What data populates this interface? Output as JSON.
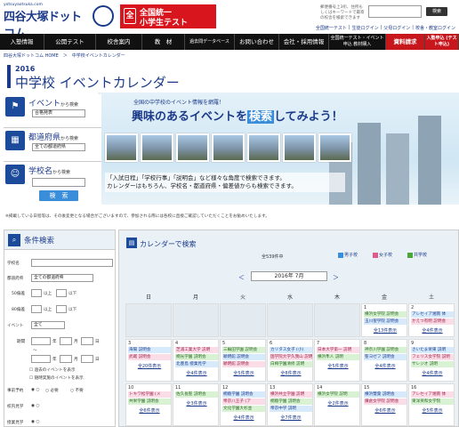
{
  "header": {
    "logo_top": "yotsuyaotsuka.com",
    "logo_main": "四谷大塚ドットコム",
    "logo_tag": "中学受験なら四谷大塚ドットコム",
    "test_l1": "全国統一",
    "test_l2": "小学生テスト",
    "test_icon": "全",
    "search_hint": "郵便番号上3桁、住所もしくはキーワードで最寄の校舎を検索できます",
    "search_btn": "検索",
    "toplinks": [
      "全国統一テスト",
      "生徒ログイン",
      "父母ログイン",
      "校舎・教室ログイン"
    ]
  },
  "nav": [
    {
      "label": "入塾情報",
      "red": false
    },
    {
      "label": "公開テスト",
      "red": false
    },
    {
      "label": "校舎案内",
      "red": false
    },
    {
      "label": "教　材",
      "red": false
    },
    {
      "label": "過去問データベース",
      "red": false,
      "small": true
    },
    {
      "label": "お問い合わせ",
      "red": false
    },
    {
      "label": "会社・採用情報",
      "red": false
    },
    {
      "label": "全国統一テスト・イベント申込 教材購入",
      "red": false,
      "small": true
    },
    {
      "label": "資料請求",
      "red": true
    },
    {
      "label": "入塾申込 (テスト申込)",
      "red": true,
      "small": true
    }
  ],
  "breadcrumb": "四谷大塚ドットコム HOME　＞　中学校イベントカレンダー",
  "title": {
    "year": "2016",
    "main": "中学校 イベントカレンダー"
  },
  "left_search": {
    "event_label": "イベント",
    "event_suffix": "から検索",
    "event_value": "合格発表",
    "pref_label": "都道府県",
    "pref_suffix": "から検索",
    "pref_value": "全ての都道府県",
    "school_label": "学校名",
    "school_suffix": "から検索",
    "button": "検　索"
  },
  "banner": {
    "top": "全国の中学校のイベント情報を網羅！",
    "big_pre": "興味のあるイベントを",
    "big_hl": "検索",
    "big_post": "してみよう！",
    "desc1": "「入試日程」「学校行事」「説明会」など様々な角度で検索できます。",
    "desc2": "カレンダーはもちろん、学校名・都道府県・偏差値からも検索できます。"
  },
  "note": "※掲載している日程等は、その後変更となる場合がございますので、参加される際には各校に直接ご確認していただくことをお勧めいたします。",
  "conditions": {
    "title": "条件検索",
    "school_name": "学校名",
    "pref": "都道府県",
    "pref_value": "全ての都道府県",
    "dev50": "50偏差",
    "dev80": "80偏差",
    "above": "以上",
    "below": "以下",
    "event": "イベント",
    "event_value": "全て",
    "period": "期間",
    "year": "年",
    "month": "月",
    "day": "日",
    "tilde": "～",
    "past": "過去のイベントを表示",
    "anytime": "随時実施のイベントを表示",
    "reserve": "事前予約",
    "reserve_opts": [
      "必要",
      "不要"
    ],
    "tour": "校内見学",
    "admission": "授業見学"
  },
  "calendar": {
    "title": "カレンダーで検索",
    "count": "全539件中",
    "legend": [
      {
        "label": "男子校",
        "color": "#3a8dd8"
      },
      {
        "label": "女子校",
        "color": "#e05a8a"
      },
      {
        "label": "共学校",
        "color": "#4aa63a"
      }
    ],
    "month": "2016年 7月",
    "prev": "＜",
    "next": "＞",
    "weekdays": [
      "日",
      "月",
      "火",
      "水",
      "木",
      "金",
      "土"
    ],
    "week1": {
      "fri_num": "1",
      "sat_num": "2",
      "fri_events": [
        "横浜女学院 説明会",
        "玉川聖学院 説明会"
      ],
      "fri_more": "全13件表示",
      "sat_events": [
        "アレセイア湘南 体",
        "かえつ有明 説明会"
      ],
      "sat_more": "全4件表示"
    },
    "week2": {
      "nums": [
        "3",
        "4",
        "5",
        "6",
        "7",
        "8",
        "9"
      ],
      "events": [
        [
          "海陽 説明会",
          "武蔵 説明会"
        ],
        [
          "芝浦工業大学 説明",
          "桐光学園 説明会",
          "北豊島 授業見学"
        ],
        [
          "三輪田学園 説明会",
          "穎明館 説明会",
          "穎明館 説明会"
        ],
        [
          "カリタス女子 (小)",
          "国学院大学久我山 説明",
          "白梅学園清修 説明"
        ],
        [
          "日本大学第一 説明",
          "横浜隼人 説明"
        ],
        [
          "神奈川学園 説明会",
          "聖ヨゼフ 説明会"
        ],
        [
          "さいたま栄東 説明",
          "フェリス女学院 説明",
          "サレジオ 説明"
        ]
      ],
      "more": [
        "全20件表示",
        "全4件表示",
        "全5件表示",
        "全8件表示",
        "全5件表示",
        "全4件表示",
        "全4件表示"
      ]
    },
    "week3": {
      "nums": [
        "10",
        "11",
        "12",
        "13",
        "14",
        "15",
        "16"
      ],
      "events": [
        [
          "トキワ松学園 (メ",
          "共栄学園 説明会"
        ],
        [
          "佐久長聖 説明会"
        ],
        [
          "桐蔭学園 説明会",
          "帝京八王子 (ア",
          "文化学園大杉並"
        ],
        [
          "横浜共立学園 説明",
          "桐蔭学園 説明会",
          "帝京中学 説明"
        ],
        [
          "横浜女学院 説明"
        ],
        [
          "横浜雙葉 説明会",
          "鎌倉女学院 説明会"
        ],
        [
          "アレセイア湘南 体",
          "東洋英和女学院"
        ]
      ],
      "more": [
        "全6件表示",
        "全3件表示",
        "全4件表示",
        "全7件表示",
        "全2件表示",
        "全6件表示",
        "全5件表示"
      ]
    }
  }
}
